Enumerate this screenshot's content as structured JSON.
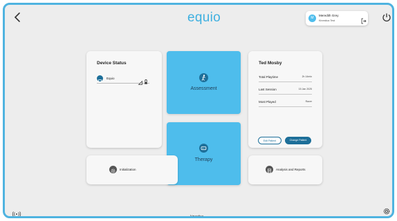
{
  "header": {
    "logo": "equio",
    "user_name": "Meredith Grey",
    "user_org": "Kinestica Test",
    "user_initial": "M"
  },
  "device_status": {
    "title": "Device Status",
    "device_name": "Equio"
  },
  "tiles": {
    "assessment": "Assessment",
    "therapy": "Therapy",
    "initialization": "Initialization",
    "analysis": "Analysis and Reports"
  },
  "patient": {
    "name": "Ted Mosby",
    "rows": [
      {
        "label": "Total Playtime",
        "value": "2h 14min"
      },
      {
        "label": "Last Session",
        "value": "15 Jan 2025"
      },
      {
        "label": "Most Played",
        "value": "Racer"
      }
    ],
    "edit_label": "Edit Patient",
    "change_label": "Change Patient"
  },
  "footer": {
    "brand": "kinestica"
  },
  "colors": {
    "accent_blue": "#4ebdec",
    "dark_blue": "#1d6f99",
    "frame": "#4fb3e0"
  },
  "icons": [
    "back-arrow-icon",
    "logout-icon",
    "power-icon",
    "device-icon",
    "signal-icon",
    "battery-icon",
    "person-icon",
    "gamepad-icon",
    "gear-icon",
    "report-icon",
    "wireless-icon",
    "settings-icon",
    "kinestica-logo-icon"
  ]
}
